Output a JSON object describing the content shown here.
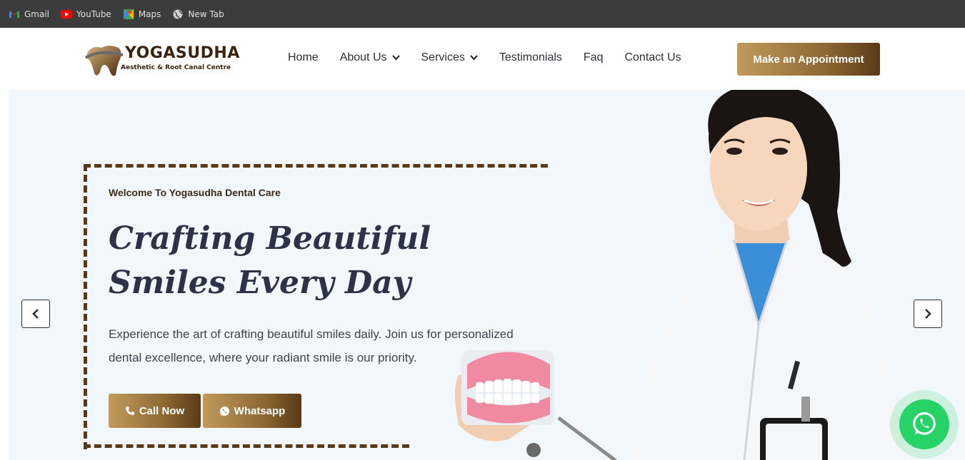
{
  "bookmarks": [
    {
      "label": "Gmail",
      "icon": "gmail-icon"
    },
    {
      "label": "YouTube",
      "icon": "youtube-icon"
    },
    {
      "label": "Maps",
      "icon": "maps-icon"
    },
    {
      "label": "New Tab",
      "icon": "globe-icon"
    }
  ],
  "logo": {
    "name": "YOGASUDHA",
    "tagline": "Aesthetic & Root Canal Centre"
  },
  "nav": {
    "items": [
      {
        "label": "Home",
        "dropdown": false
      },
      {
        "label": "About Us",
        "dropdown": true
      },
      {
        "label": "Services",
        "dropdown": true
      },
      {
        "label": "Testimonials",
        "dropdown": false
      },
      {
        "label": "Faq",
        "dropdown": false
      },
      {
        "label": "Contact Us",
        "dropdown": false
      }
    ],
    "appointment_label": "Make an Appointment"
  },
  "hero": {
    "welcome": "Welcome To Yogasudha Dental Care",
    "headline": "Crafting Beautiful Smiles Every Day",
    "description": "Experience the art of crafting beautiful smiles daily. Join us for personalized dental excellence, where your radiant smile is our priority.",
    "call_label": "Call Now",
    "whatsapp_label": "Whatsapp"
  },
  "colors": {
    "brand_brown": "#5a3a16",
    "brand_gold": "#c19a5b",
    "hero_bg": "#f2f7fb",
    "whatsapp_green": "#25d366",
    "bookmarks_bg": "#3c3c3c"
  }
}
